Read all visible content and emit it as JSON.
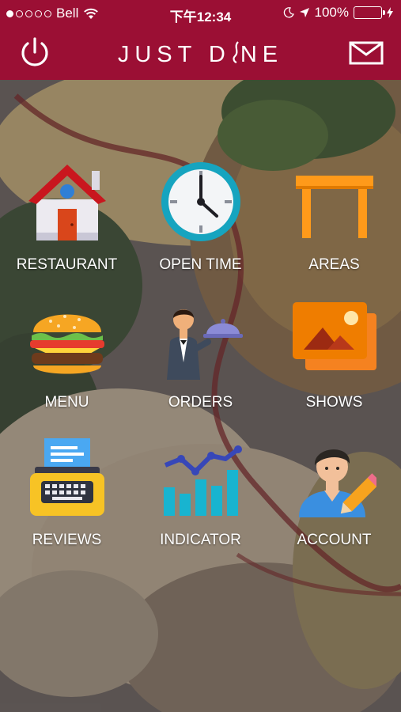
{
  "status_bar": {
    "carrier": "Bell",
    "time": "下午12:34",
    "battery": "100%",
    "battery_level": 1.0
  },
  "header": {
    "title": "JUST D",
    "title_rest": "NE",
    "icons": {
      "left": "power-icon",
      "right": "mail-icon"
    },
    "color": "#9b0f34"
  },
  "tiles": [
    {
      "label": "RESTAURANT",
      "icon": "house-icon"
    },
    {
      "label": "OPEN TIME",
      "icon": "clock-icon"
    },
    {
      "label": "AREAS",
      "icon": "table-icon"
    },
    {
      "label": "MENU",
      "icon": "burger-icon"
    },
    {
      "label": "ORDERS",
      "icon": "waiter-icon"
    },
    {
      "label": "SHOWS",
      "icon": "gallery-icon"
    },
    {
      "label": "REVIEWS",
      "icon": "typewriter-icon"
    },
    {
      "label": "INDICATOR",
      "icon": "bar-chart-icon"
    },
    {
      "label": "ACCOUNT",
      "icon": "account-icon"
    }
  ]
}
